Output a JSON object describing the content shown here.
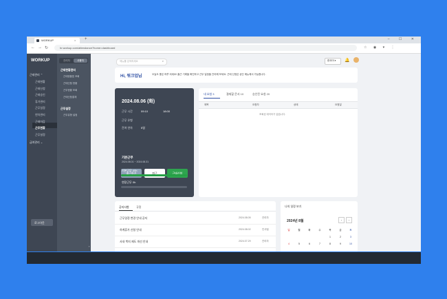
{
  "browser": {
    "tab_title": "WORKUP",
    "tab_close": "×",
    "tab_new": "+",
    "url": "hr.workup.com/attendance?home=dashboard",
    "window_controls": "– ☐ ✕",
    "nav_back": "←",
    "nav_forward": "→",
    "nav_reload": "↻",
    "ext_icons": "☆ ◉ ▾ ⋮"
  },
  "sidebar": {
    "logo": "WORKUP",
    "group1": "근태관리 ⌃",
    "items": [
      "근태현황",
      "근태신청",
      "근태승인",
      "휴가관리",
      "근무일정",
      "연차관리",
      "근태마감",
      "근무현황",
      "근무설정"
    ],
    "active_index": 7,
    "group2": "급여관리 ⌄",
    "logout": "로그아웃"
  },
  "subnav": {
    "toggle_left": "관리자",
    "toggle_right": "사용자",
    "sections": [
      {
        "title": "근태현황관리",
        "items": [
          "근태현황표 조회",
          "근태신청 현황",
          "근무현황 조회",
          "근태신청결재"
        ]
      },
      {
        "title": "근무설정",
        "items": [
          "근무유형 설정"
        ]
      }
    ]
  },
  "topbar": {
    "search_placeholder": "메뉴를 검색하세요",
    "search_icon": "⌕",
    "language": "한국어 ▾",
    "bell": "🔔"
  },
  "greeting": {
    "hi": "Hi, 워크업님",
    "message": "오늘도 좋은 하루 되세요! 출근 기록을 확인하고 근무 일정을 관리해 보세요. 근태 신청은 상단 메뉴에서 가능합니다."
  },
  "attendance": {
    "date": "2024.08.06 (화)",
    "work_time_label": "근무 시간",
    "start_time": "09:10",
    "end_time": "18:00",
    "work_type_label": "근무 유형",
    "work_type": "",
    "remaining_label": "잔여 연차",
    "remaining": "5일",
    "btn_checkin": "출근하기",
    "btn_checkout": "퇴근",
    "btn_request": "근태신청",
    "period_title": "기본근무",
    "period_range": "2024.08.01 ~ 2024.08.31",
    "stat1_label": "기본근무",
    "stat1_value": "40h",
    "stat2_label": "연장근무",
    "stat2_value": "0h",
    "stat1_fill": 1.0,
    "stat2_fill": 0.0
  },
  "requests": {
    "tabs": [
      "내 요청 3",
      "결재할 문서 10",
      "승인된 요청 20"
    ],
    "columns": [
      "제목",
      "요청자",
      "상태",
      "요청일"
    ],
    "empty": "조회된 데이터가 없습니다."
  },
  "notices": {
    "tabs": [
      "공지사항",
      "규정"
    ],
    "rows": [
      {
        "title": "근무일정 변경 안내 공지",
        "date": "2024.08.05",
        "writer": "관리자"
      },
      {
        "title": "하계휴가 신청 안내",
        "date": "2024.08.02",
        "writer": "인사팀"
      },
      {
        "title": "사내 복지 제도 개선 안내",
        "date": "2024.07.29",
        "writer": "관리자"
      }
    ]
  },
  "calendar": {
    "title": "나의 일정 보기",
    "month": "2024년 8월",
    "prev": "‹",
    "next": "›",
    "weekdays": [
      "일",
      "월",
      "화",
      "수",
      "목",
      "금",
      "토"
    ],
    "weeks": [
      [
        "",
        "",
        "",
        "",
        "1",
        "2",
        "3"
      ],
      [
        "4",
        "5",
        "6",
        "7",
        "8",
        "9",
        "10"
      ]
    ]
  }
}
